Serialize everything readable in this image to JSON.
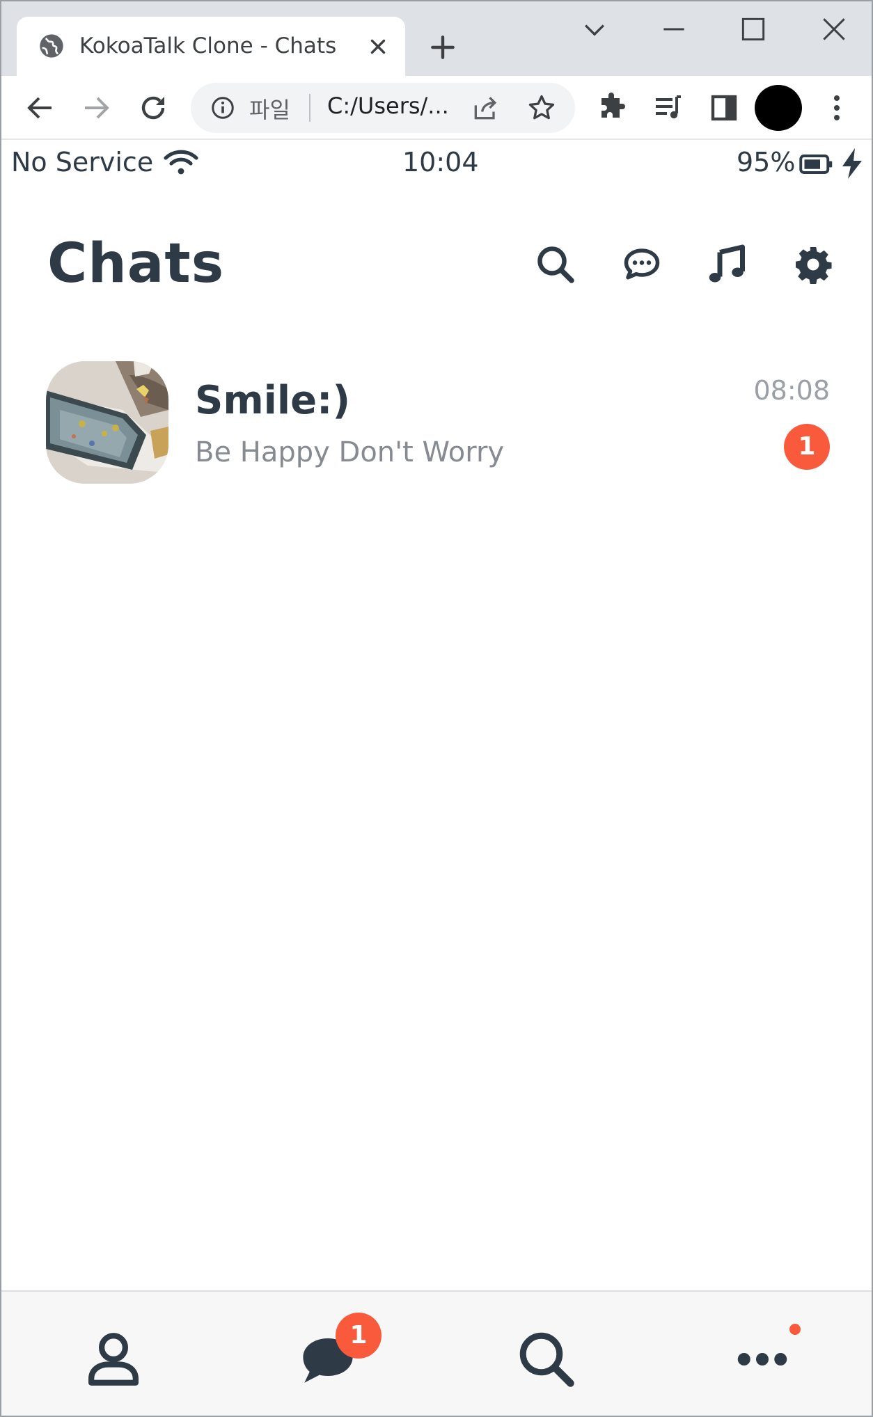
{
  "browser": {
    "tab_title": "KokoaTalk Clone - Chats",
    "omnibox": {
      "scheme_label": "파일",
      "url": "C:/Users/..."
    }
  },
  "status_bar": {
    "carrier": "No Service",
    "time": "10:04",
    "battery_percent": "95%"
  },
  "header": {
    "title": "Chats",
    "icons": [
      "search-icon",
      "chat-bubble-icon",
      "music-note-icon",
      "gear-icon"
    ]
  },
  "chats": [
    {
      "name": "Smile:)",
      "preview": "Be Happy Don't Worry",
      "time": "08:08",
      "unread": "1"
    }
  ],
  "tab_bar": {
    "items": [
      "person-icon",
      "chat-icon",
      "search-icon",
      "more-icon"
    ],
    "chats_badge": "1"
  },
  "colors": {
    "text": "#2e3a46",
    "accent_badge": "#fa5a3c",
    "muted": "#868b91"
  }
}
